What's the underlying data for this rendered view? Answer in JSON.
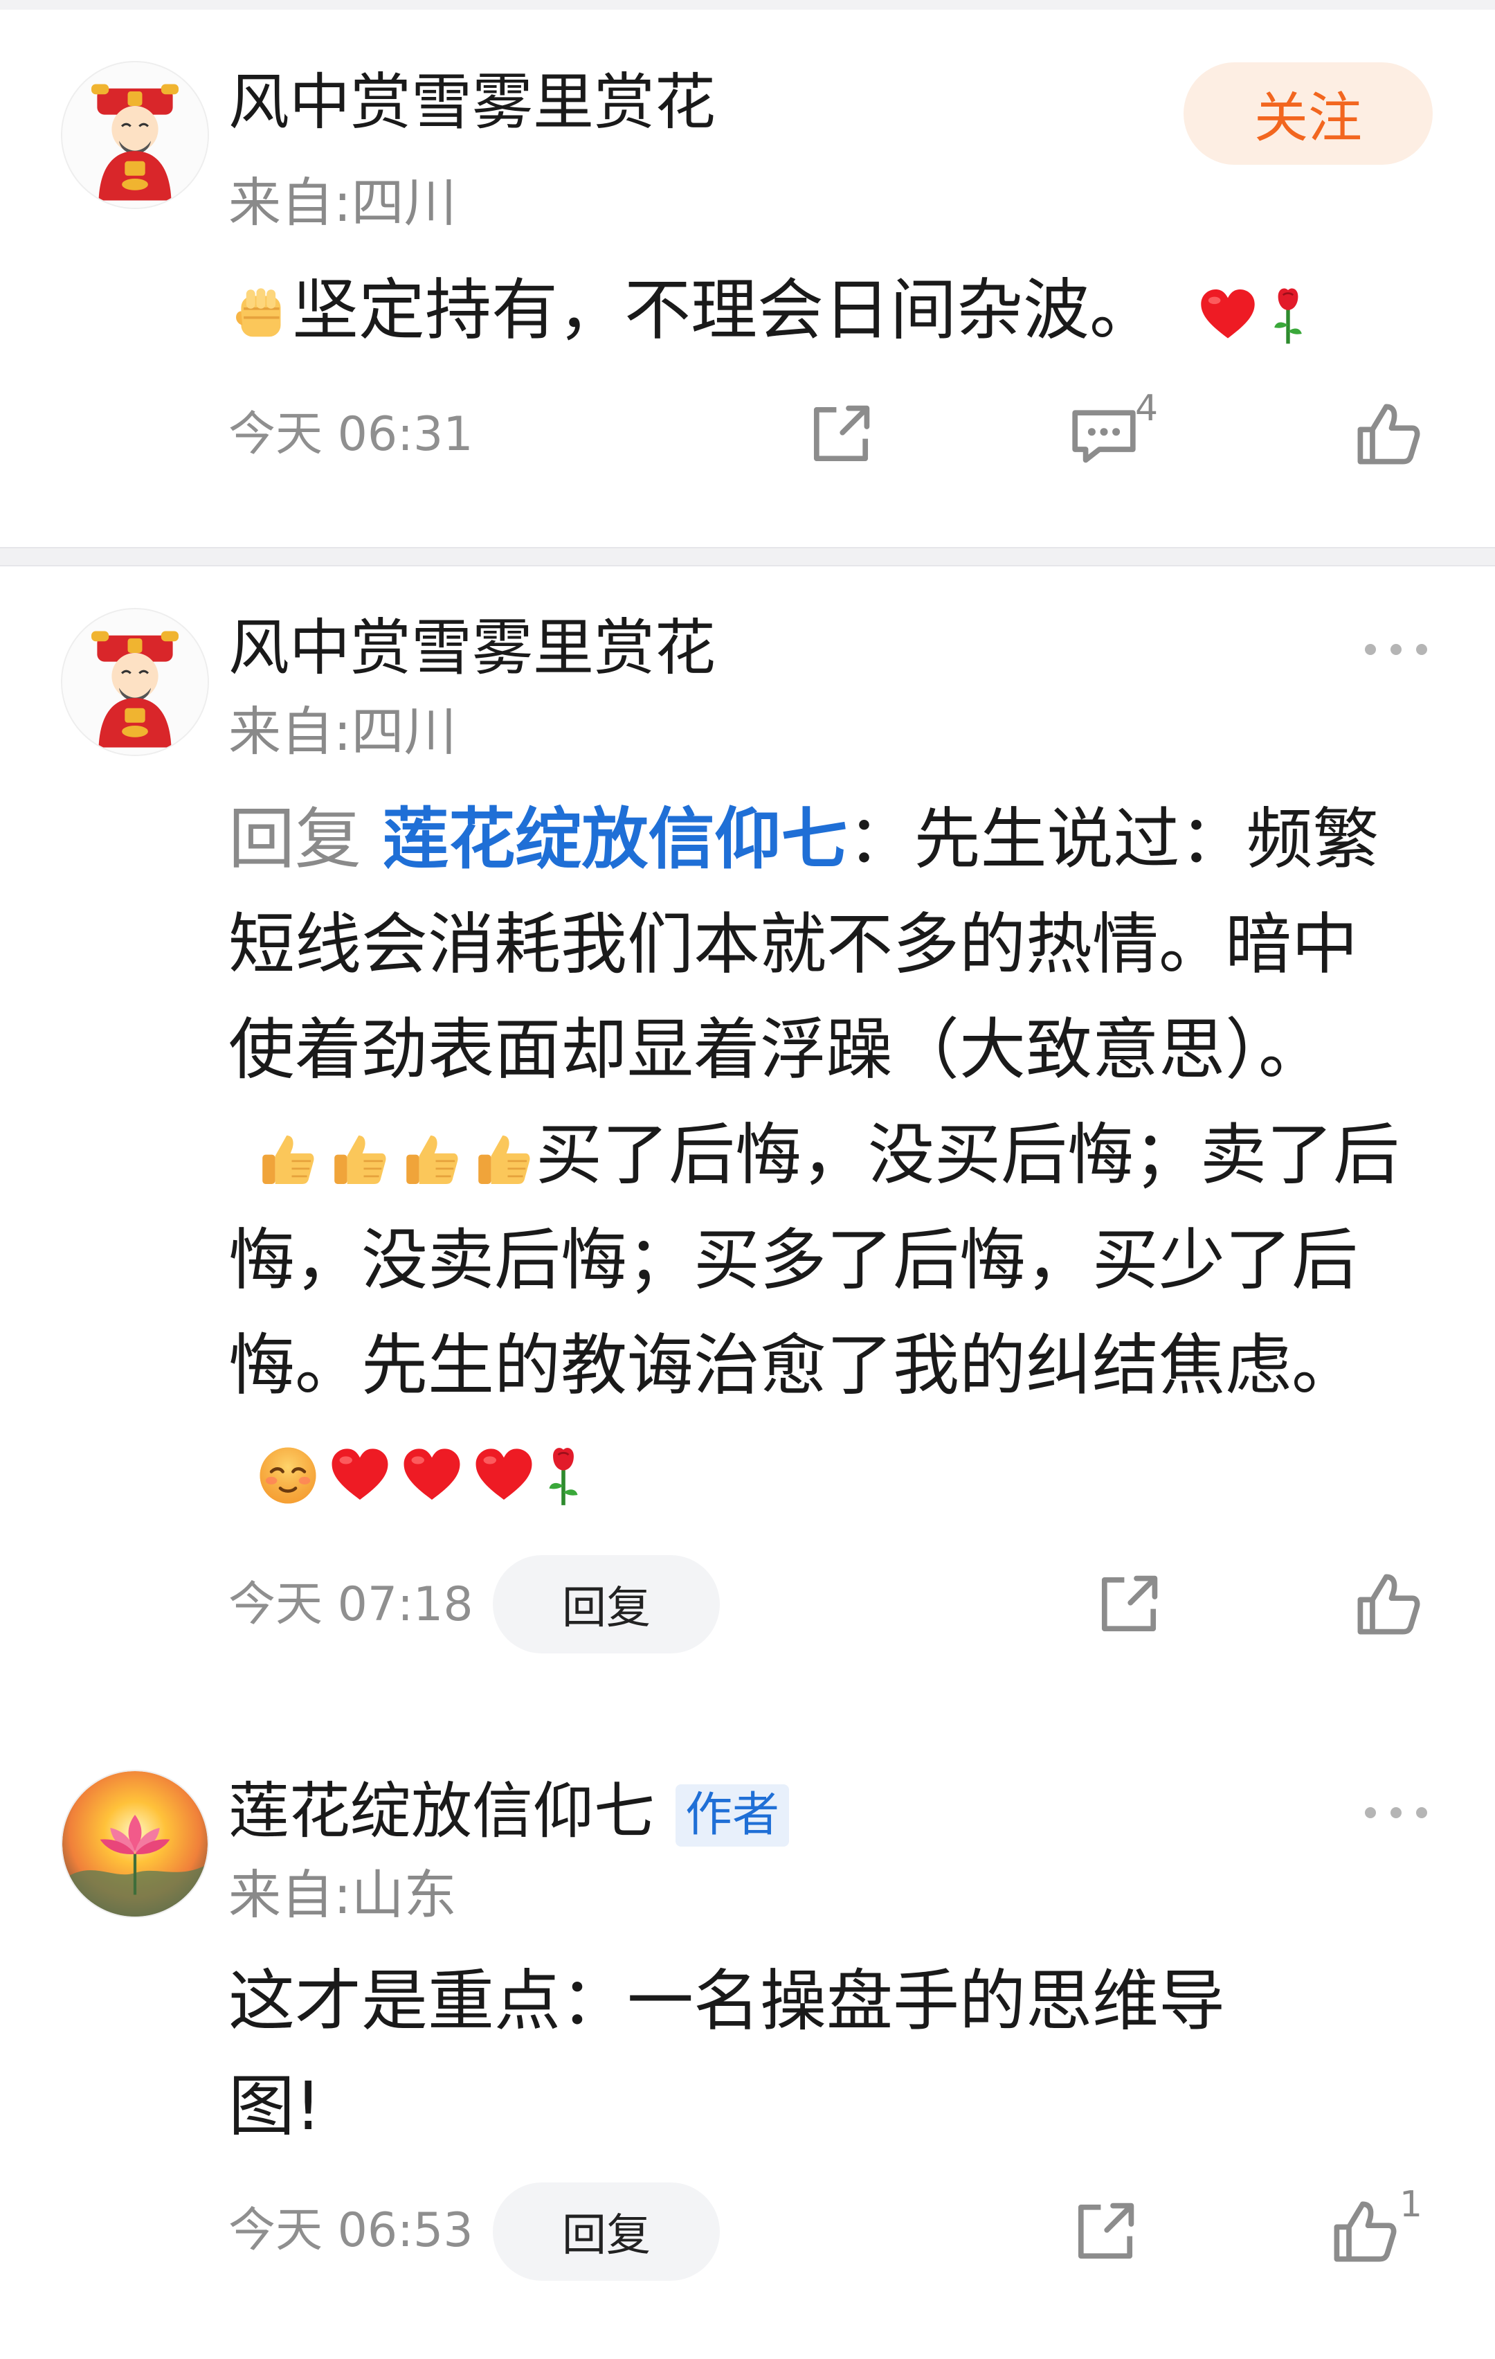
{
  "comments": [
    {
      "user": "风中赏雪雾里赏花",
      "location": "来自:四川",
      "text": "坚定持有，不理会日间杂波。",
      "time": "今天 06:31",
      "follow_label": "关注",
      "comment_count": "4"
    },
    {
      "user": "风中赏雪雾里赏花",
      "location": "来自:四川",
      "reply_prefix": "回复",
      "mention": "莲花绽放信仰七",
      "text_1": "：先生说过：频繁短线会消耗我们本就不多的热情。暗中使着劲表面却显着浮躁（大致意思）。",
      "text_2": "买了后悔，没买后悔；卖了后悔，没卖后悔；买多了后悔，买少了后悔。先生的教诲治愈了我的纠结焦虑。",
      "time": "今天 07:18",
      "reply_label": "回复"
    },
    {
      "user": "莲花绽放信仰七",
      "badge": "作者",
      "location": "来自:山东",
      "text": "这才是重点：一名操盘手的思维导图!",
      "time": "今天 06:53",
      "reply_label": "回复",
      "like_count": "1"
    }
  ],
  "icons": {
    "share": "share-icon",
    "comment": "comment-icon",
    "like": "thumbs-up-icon",
    "more": "more-dots-icon",
    "fist": "raised-fist-emoji",
    "heart": "red-heart-emoji",
    "rose": "rose-emoji",
    "thumb": "thumbs-up-emoji",
    "smile": "smiling-face-emoji"
  },
  "colors": {
    "accent_orange": "#f2661f",
    "link_blue": "#1f6fd6",
    "muted_gray": "#8a8a8a"
  }
}
